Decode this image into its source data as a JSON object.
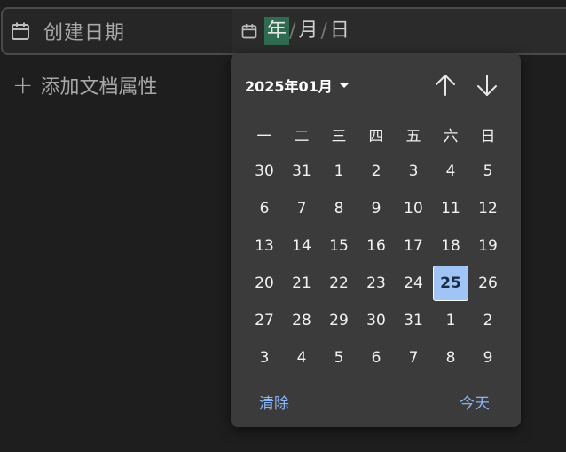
{
  "property": {
    "label": "创建日期",
    "icon": "calendar-icon"
  },
  "date_input": {
    "icon": "calendar-icon",
    "year_placeholder": "年",
    "month_placeholder": "月",
    "day_placeholder": "日",
    "separator": "/"
  },
  "add_property": {
    "plus": "+",
    "label": "添加文档属性"
  },
  "picker": {
    "month_label": "2025年01月",
    "prev_icon": "arrow-up-icon",
    "next_icon": "arrow-down-icon",
    "weekdays": [
      "一",
      "二",
      "三",
      "四",
      "五",
      "六",
      "日"
    ],
    "weeks": [
      [
        "30",
        "31",
        "1",
        "2",
        "3",
        "4",
        "5"
      ],
      [
        "6",
        "7",
        "8",
        "9",
        "10",
        "11",
        "12"
      ],
      [
        "13",
        "14",
        "15",
        "16",
        "17",
        "18",
        "19"
      ],
      [
        "20",
        "21",
        "22",
        "23",
        "24",
        "25",
        "26"
      ],
      [
        "27",
        "28",
        "29",
        "30",
        "31",
        "1",
        "2"
      ],
      [
        "3",
        "4",
        "5",
        "6",
        "7",
        "8",
        "9"
      ]
    ],
    "selected_day": "25",
    "clear_label": "清除",
    "today_label": "今天",
    "selected_color": "#9fc4f5",
    "link_color": "#8ab4f8"
  }
}
